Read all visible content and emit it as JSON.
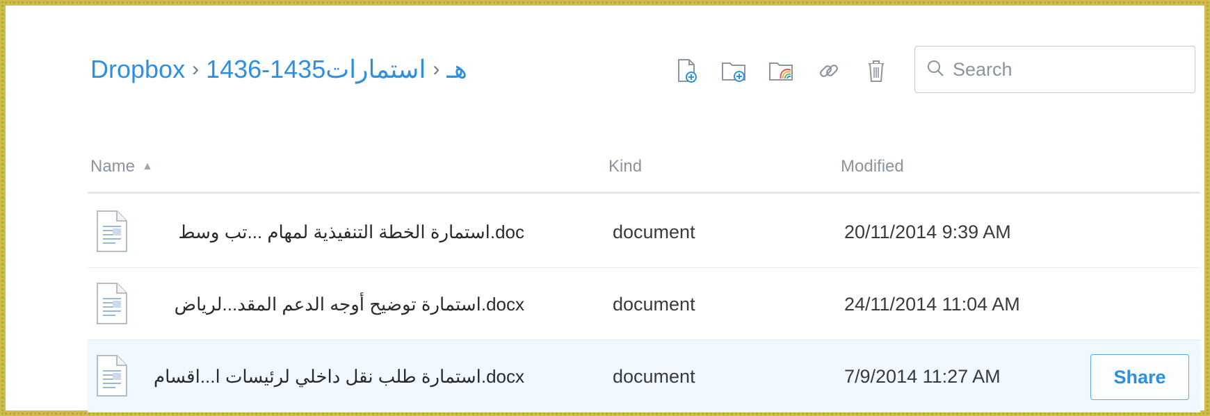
{
  "breadcrumb": {
    "root": "Dropbox",
    "folder": "استمارات1435-1436",
    "current": "هـ"
  },
  "toolbar": {
    "icons": [
      "new-file-icon",
      "new-folder-icon",
      "shared-folder-icon",
      "link-icon",
      "trash-icon"
    ]
  },
  "search": {
    "placeholder": "Search"
  },
  "table": {
    "headers": {
      "name": "Name",
      "kind": "Kind",
      "modified": "Modified"
    },
    "sort_indicator": "▲",
    "rows": [
      {
        "name": "استمارة الخطة التنفيذية لمهام ...تب وسط.doc",
        "kind": "document",
        "modified": "20/11/2014 9:39 AM"
      },
      {
        "name": "استمارة توضيح أوجه الدعم المقد...لرياض.docx",
        "kind": "document",
        "modified": "24/11/2014 11:04 AM"
      },
      {
        "name": "استمارة طلب نقل داخلي لرئيسات ا...اقسام.docx",
        "kind": "document",
        "modified": "7/9/2014 11:27 AM",
        "action": "Share"
      }
    ]
  },
  "colors": {
    "accent": "#2d8fe0",
    "selected_row": "#f1f8fe",
    "frame_gold": "#d8b84a",
    "frame_green": "#8fbf3a"
  }
}
